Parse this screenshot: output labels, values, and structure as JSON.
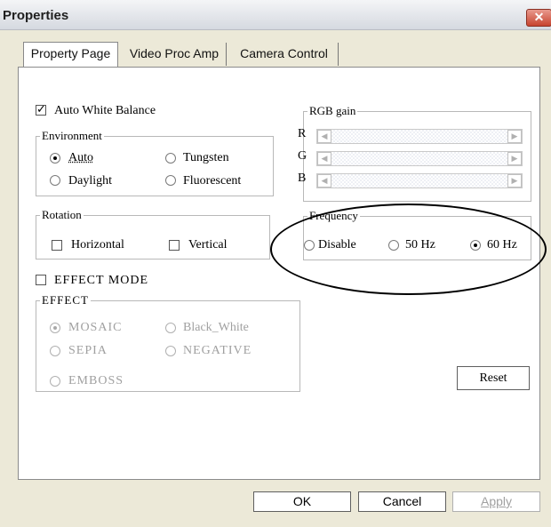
{
  "window": {
    "title": "Properties",
    "close_glyph": "✕"
  },
  "tabs": [
    "Property Page",
    "Video Proc Amp",
    "Camera Control"
  ],
  "auto_white_balance": {
    "label": "Auto White Balance",
    "checked": true
  },
  "environment": {
    "label": "Environment",
    "options": [
      {
        "label": "Auto",
        "selected": true
      },
      {
        "label": "Tungsten",
        "selected": false
      },
      {
        "label": "Daylight",
        "selected": false
      },
      {
        "label": "Fluorescent",
        "selected": false
      }
    ]
  },
  "rgb_gain": {
    "label": "RGB gain",
    "channels": [
      "R",
      "G",
      "B"
    ]
  },
  "rotation": {
    "label": "Rotation",
    "options": [
      {
        "label": "Horizontal",
        "checked": false
      },
      {
        "label": "Vertical",
        "checked": false
      }
    ]
  },
  "frequency": {
    "label": "Frequency",
    "options": [
      {
        "label": "Disable",
        "selected": false
      },
      {
        "label": "50 Hz",
        "selected": false
      },
      {
        "label": "60 Hz",
        "selected": true
      }
    ]
  },
  "effect_mode": {
    "label": "EFFECT MODE",
    "checked": false
  },
  "effect": {
    "label": "EFFECT",
    "options": [
      {
        "label": "MOSAIC",
        "selected": true
      },
      {
        "label": "Black_White",
        "selected": false
      },
      {
        "label": "SEPIA",
        "selected": false
      },
      {
        "label": "NEGATIVE",
        "selected": false
      },
      {
        "label": "EMBOSS",
        "selected": false
      }
    ]
  },
  "buttons": {
    "reset": "Reset",
    "ok": "OK",
    "cancel": "Cancel",
    "apply": "Apply"
  }
}
